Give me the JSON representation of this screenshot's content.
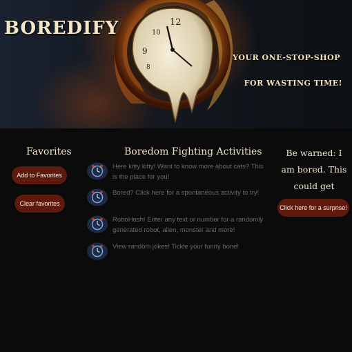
{
  "brand": {
    "name": "BOREDIFY"
  },
  "banner": {
    "tagline_1": "YOUR ONE-STOP-SHOP",
    "tagline_2": "FOR WASTING TIME!",
    "colors": {
      "glow": "#ffaa28",
      "clock_face": "#efe6d0"
    }
  },
  "favorites": {
    "title": "Favorites",
    "add_label": "Add to Favorites",
    "clear_label": "Clear favorites"
  },
  "activities": {
    "title": "Boredom Fighting Activities",
    "items": [
      {
        "text": "Here kitty kitty! Want to know more about cats? This is the place for you!",
        "icon": "clock-icon"
      },
      {
        "text": "Bored? Click here for a spontaneous activity to try!",
        "icon": "clock-icon"
      },
      {
        "text": "RoboHash! Enter any text or number for a randomly generated robot, alien, monster and more!",
        "icon": "clock-icon"
      },
      {
        "text": "View random jokes! Tickle your funny bone!",
        "icon": "clock-icon"
      }
    ]
  },
  "surprise": {
    "warning": "Be warned: I am bored. This could get dangerous.",
    "button_label": "Click here for a surprise!"
  },
  "colors": {
    "button_bg": "#5e1a0d",
    "heading_text": "#f1e4c6",
    "body_text": "#6a6a70"
  }
}
